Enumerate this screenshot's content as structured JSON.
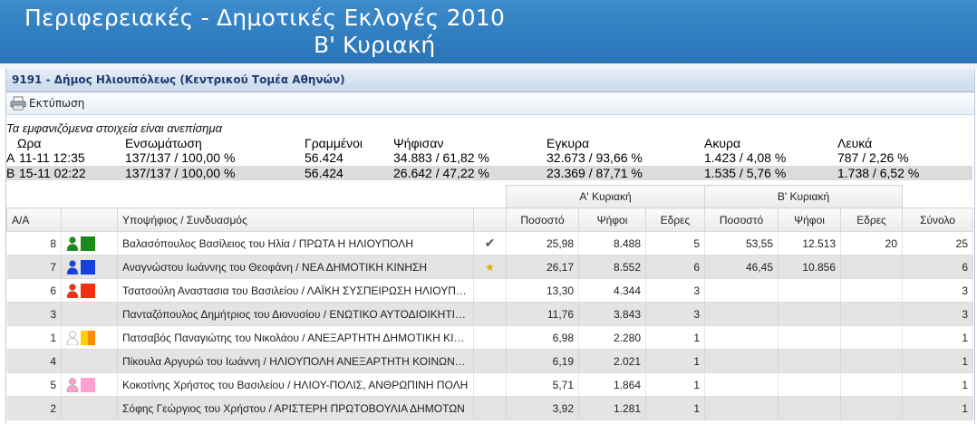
{
  "header": {
    "title_line1": "Περιφερειακές - Δημοτικές Εκλογές 2010",
    "title_line2": "Β' Κυριακή"
  },
  "panel": {
    "title": "9191 - Δήμος Ηλιουπόλεως (Κεντρικού Τομέα Αθηνών)",
    "print_label": "Εκτύπωση"
  },
  "notice": "Τα εμφανιζόμενα στοιχεία είναι ανεπίσημα",
  "summary": {
    "headers": [
      "Ωρα",
      "Ενσωμάτωση",
      "Γραμμένοι",
      "Ψήφισαν",
      "Εγκυρα",
      "Ακυρα",
      "Λευκά"
    ],
    "rows": [
      {
        "label": "Α",
        "time": "11-11 12:35",
        "integration": "137/137 / 100,00 %",
        "registered": "56.424",
        "voted": "34.883 / 61,82 %",
        "valid": "32.673 / 93,66 %",
        "invalid": "1.423 / 4,08 %",
        "blank": "787 / 2,26 %"
      },
      {
        "label": "Β",
        "time": "15-11 02:22",
        "integration": "137/137 / 100,00 %",
        "registered": "56.424",
        "voted": "26.642 / 47,22 %",
        "valid": "23.369 / 87,71 %",
        "invalid": "1.535 / 5,76 %",
        "blank": "1.738 / 6,52 %"
      }
    ]
  },
  "table": {
    "group_a": "Α' Κυριακή",
    "group_b": "Β' Κυριακή",
    "columns": {
      "aa": "Α/Α",
      "candidate": "Υποψήφιος / Συνδυασμός",
      "pct_a": "Ποσοστό",
      "votes_a": "Ψήφοι",
      "seats_a": "Εδρες",
      "pct_b": "Ποσοστό",
      "votes_b": "Ψήφοι",
      "seats_b": "Εδρες",
      "total": "Σύνολο"
    },
    "rows": [
      {
        "aa": "8",
        "person": "person-green",
        "color": "#1a8a1a",
        "color2": "",
        "name": "Βαλασόπουλος Βασίλειος του Ηλία / ΠΡΩΤΑ Η ΗΛΙΟΥΠΟΛΗ",
        "mark": "✔",
        "pct_a": "25,98",
        "votes_a": "8.488",
        "seats_a": "5",
        "pct_b": "53,55",
        "votes_b": "12.513",
        "seats_b": "20",
        "total": "25"
      },
      {
        "aa": "7",
        "person": "person-blue",
        "color": "#1640e0",
        "color2": "",
        "name": "Αναγνώστου Ιωάννης του Θεοφάνη / ΝΕΑ ΔΗΜΟΤΙΚΗ ΚΙΝΗΣΗ",
        "mark": "★",
        "pct_a": "26,17",
        "votes_a": "8.552",
        "seats_a": "6",
        "pct_b": "46,45",
        "votes_b": "10.856",
        "seats_b": "",
        "total": "6"
      },
      {
        "aa": "6",
        "person": "person-red",
        "color": "#f03010",
        "color2": "",
        "name": "Τσατσούλη Αναστασια του Βασιλείου / ΛΑΪΚΗ ΣΥΣΠΕΙΡΩΣΗ ΗΛΙΟΥΠΟΛΗΣ",
        "mark": "",
        "pct_a": "13,30",
        "votes_a": "4.344",
        "seats_a": "3",
        "pct_b": "",
        "votes_b": "",
        "seats_b": "",
        "total": "3"
      },
      {
        "aa": "3",
        "person": "",
        "color": "",
        "color2": "",
        "name": "Πανταζόπουλος Δημήτριος του Διονυσίου / ΕΝΩΤΙΚΟ ΑΥΤΟΔΙΟΙΚΗΤΙΚΟ",
        "mark": "",
        "pct_a": "11,76",
        "votes_a": "3.843",
        "seats_a": "3",
        "pct_b": "",
        "votes_b": "",
        "seats_b": "",
        "total": "3"
      },
      {
        "aa": "1",
        "person": "person-white",
        "color": "#ffd000",
        "color2": "#ff8c00",
        "name": "Πατσαβός Παναγιώτης του Νικολάου / ΑΝΕΞΑΡΤΗΤΗ ΔΗΜΟΤΙΚΗ ΚΙΝΗΣΗ",
        "mark": "",
        "pct_a": "6,98",
        "votes_a": "2.280",
        "seats_a": "1",
        "pct_b": "",
        "votes_b": "",
        "seats_b": "",
        "total": "1"
      },
      {
        "aa": "4",
        "person": "",
        "color": "",
        "color2": "",
        "name": "Πίκουλα Αργυρώ του Ιωάννη / ΗΛΙΟΥΠΟΛΗ ΑΝΕΞΑΡΤΗΤΗ ΚΟΙΝΩΝΙΚΗ",
        "mark": "",
        "pct_a": "6,19",
        "votes_a": "2.021",
        "seats_a": "1",
        "pct_b": "",
        "votes_b": "",
        "seats_b": "",
        "total": "1"
      },
      {
        "aa": "5",
        "person": "person-pink",
        "color": "#ffa0d0",
        "color2": "",
        "name": "Κοκοτίνης Χρήστος του Βασιλείου / ΗΛΙΟΥ-ΠΟΛΙΣ, ΑΝΘΡΩΠΙΝΗ ΠΟΛΗ",
        "mark": "",
        "pct_a": "5,71",
        "votes_a": "1.864",
        "seats_a": "1",
        "pct_b": "",
        "votes_b": "",
        "seats_b": "",
        "total": "1"
      },
      {
        "aa": "2",
        "person": "",
        "color": "",
        "color2": "",
        "name": "Σόφης Γεώργιος του Χρήστου / ΑΡΙΣΤΕΡΗ ΠΡΩΤΟΒΟΥΛΙΑ ΔΗΜΟΤΩΝ",
        "mark": "",
        "pct_a": "3,92",
        "votes_a": "1.281",
        "seats_a": "1",
        "pct_b": "",
        "votes_b": "",
        "seats_b": "",
        "total": "1"
      }
    ]
  },
  "colors": {
    "header_bg": "#3a86c6",
    "panel_title_text": "#1f3b6f",
    "alt_row": "#e4e4e4",
    "check": "#555555",
    "star": "#e0b000"
  }
}
